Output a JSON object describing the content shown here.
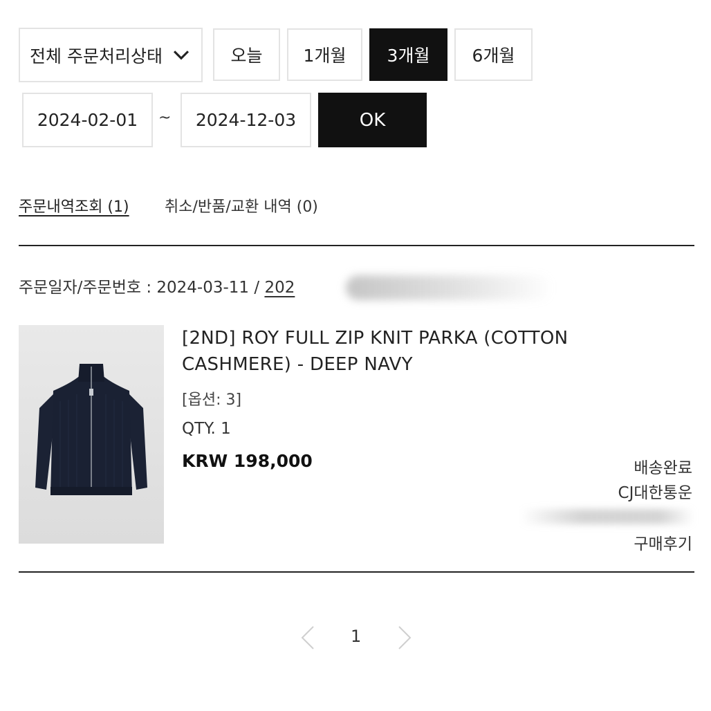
{
  "filters": {
    "status_select_value": "전체 주문처리상태",
    "periods": [
      "오늘",
      "1개월",
      "3개월",
      "6개월"
    ],
    "active_period": "3개월",
    "date_start": "2024-02-01",
    "date_separator": "~",
    "date_end": "2024-12-03",
    "ok_label": "OK"
  },
  "tabs": {
    "orders": "주문내역조회 (1)",
    "cancels": "취소/반품/교환 내역 (0)"
  },
  "order": {
    "meta_label": "주문일자/주문번호 : 2024-03-11 / ",
    "number_visible": "202",
    "product": {
      "name": "[2ND] ROY FULL ZIP KNIT PARKA (COTTON CASHMERE) - DEEP NAVY",
      "option": "[옵션: 3]",
      "qty": "QTY. 1",
      "price": "KRW 198,000"
    },
    "delivery_status": "배송완료",
    "courier": "CJ대한통운",
    "review_label": "구매후기"
  },
  "pagination": {
    "current_page": "1"
  },
  "colors": {
    "active_bg": "#111111",
    "border": "#e3e3e3",
    "text": "#222222",
    "product_navy": "#1a2133"
  },
  "icons": [
    "chevron-down-icon",
    "chevron-left-icon",
    "chevron-right-icon"
  ]
}
